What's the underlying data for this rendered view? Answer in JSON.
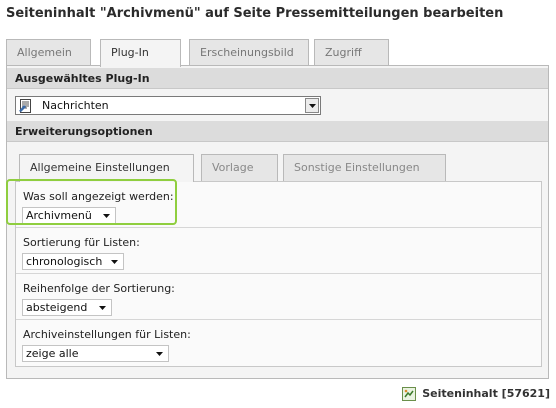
{
  "title": "Seiteninhalt \"Archivmenü\" auf Seite Pressemitteilungen bearbeiten",
  "outer_tabs": [
    {
      "label": "Allgemein",
      "active": false
    },
    {
      "label": "Plug-In",
      "active": true
    },
    {
      "label": "Erscheinungsbild",
      "active": false
    },
    {
      "label": "Zugriff",
      "active": false
    }
  ],
  "plugin_section": {
    "heading": "Ausgewähltes Plug-In",
    "selected_value": "Nachrichten",
    "icon": "document-plugin-icon"
  },
  "extension_section": {
    "heading": "Erweiterungsoptionen"
  },
  "inner_tabs": [
    {
      "label": "Allgemeine Einstellungen",
      "active": true
    },
    {
      "label": "Vorlage",
      "active": false
    },
    {
      "label": "Sonstige Einstellungen",
      "active": false
    }
  ],
  "fields": [
    {
      "label": "Was soll angezeigt werden:",
      "value": "Archivmenü",
      "highlighted": true
    },
    {
      "label": "Sortierung für Listen:",
      "value": "chronologisch",
      "highlighted": false
    },
    {
      "label": "Reihenfolge der Sortierung:",
      "value": "absteigend",
      "highlighted": false
    },
    {
      "label": "Archiveinstellungen für Listen:",
      "value": "zeige alle",
      "highlighted": false
    }
  ],
  "footer": {
    "text": "Seiteninhalt [57621]",
    "icon": "content-element-icon"
  },
  "colors": {
    "highlight": "#8fce3f",
    "section_header_bg": "#dcdcdc",
    "panel_bg": "#f4f4f4"
  }
}
